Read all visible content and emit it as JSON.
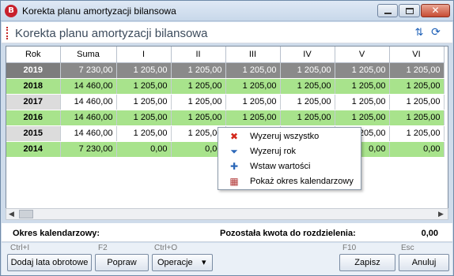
{
  "window": {
    "title": "Korekta planu amortyzacji bilansowa",
    "app_icon_glyph": "B"
  },
  "header": {
    "title": "Korekta planu amortyzacji bilansowa"
  },
  "grid": {
    "columns": [
      "Rok",
      "Suma",
      "I",
      "II",
      "III",
      "IV",
      "V",
      "VI"
    ],
    "rows": [
      {
        "style": "sel",
        "cells": [
          "2019",
          "7 230,00",
          "1 205,00",
          "1 205,00",
          "1 205,00",
          "1 205,00",
          "1 205,00",
          "1 205,00"
        ]
      },
      {
        "style": "green",
        "cells": [
          "2018",
          "14 460,00",
          "1 205,00",
          "1 205,00",
          "1 205,00",
          "1 205,00",
          "1 205,00",
          "1 205,00"
        ]
      },
      {
        "style": "white",
        "cells": [
          "2017",
          "14 460,00",
          "1 205,00",
          "1 205,00",
          "1 205,00",
          "1 205,00",
          "1 205,00",
          "1 205,00"
        ]
      },
      {
        "style": "green",
        "cells": [
          "2016",
          "14 460,00",
          "1 205,00",
          "1 205,00",
          "1 205,00",
          "1 205,00",
          "1 205,00",
          "1 205,00"
        ]
      },
      {
        "style": "white",
        "cells": [
          "2015",
          "14 460,00",
          "1 205,00",
          "1 205,00",
          "",
          "",
          "1 205,00",
          "1 205,00"
        ]
      },
      {
        "style": "green",
        "cells": [
          "2014",
          "7 230,00",
          "0,00",
          "0,00",
          "",
          "",
          "0,00",
          "0,00"
        ]
      }
    ]
  },
  "context_menu": {
    "items": [
      {
        "label": "Wyzeruj wszystko",
        "icon": "red-x-icon"
      },
      {
        "label": "Wyzeruj rok",
        "icon": "filter-clear-icon"
      },
      {
        "label": "Wstaw wartości",
        "icon": "puzzle-icon"
      },
      {
        "label": "Pokaż okres kalendarzowy",
        "icon": "calendar-icon"
      }
    ]
  },
  "summary": {
    "okres_label": "Okres kalendarzowy:",
    "pozostala_label": "Pozostała kwota do rozdzielenia:",
    "pozostala_value": "0,00"
  },
  "footer": {
    "buttons": [
      {
        "shortcut": "Ctrl+I",
        "label": "Dodaj lata obrotowe"
      },
      {
        "shortcut": "F2",
        "label": "Popraw"
      },
      {
        "shortcut": "Ctrl+O",
        "label": "Operacje"
      },
      {
        "shortcut": "F10",
        "label": "Zapisz"
      },
      {
        "shortcut": "Esc",
        "label": "Anuluj"
      }
    ],
    "operacje_dropdown_glyph": "▾"
  },
  "colors": {
    "selected_row": "#8a8a8a",
    "green_row": "#a8e38c",
    "close_button": "#c74c33",
    "accent_blue": "#1c5fb7",
    "app_icon_red": "#c8202c"
  }
}
